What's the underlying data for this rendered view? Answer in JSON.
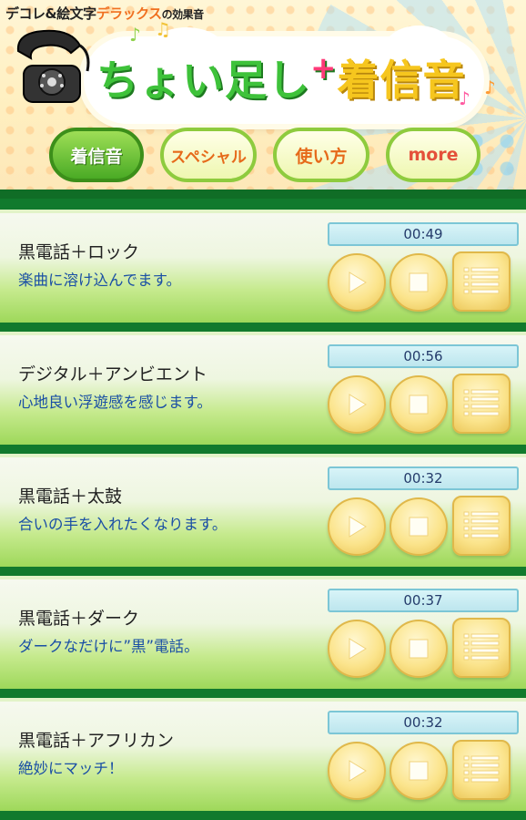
{
  "header": {
    "brand_prefix": "デコレ&絵文字",
    "brand_deluxe": "デラックス",
    "brand_suffix": "の効果音",
    "logo_part1": "ちょい足し",
    "logo_plus": "+",
    "logo_part2": "着信音",
    "icons": [
      "telephone-icon",
      "music-note-icon"
    ]
  },
  "nav": {
    "tabs": [
      {
        "label": "着信音",
        "active": true
      },
      {
        "label": "スペシャル",
        "active": false
      },
      {
        "label": "使い方",
        "active": false
      },
      {
        "label": "more",
        "active": false
      }
    ]
  },
  "ringtones": [
    {
      "title": "黒電話＋ロック",
      "desc": "楽曲に溶け込んでます。",
      "time": "00:49"
    },
    {
      "title": "デジタル＋アンビエント",
      "desc": "心地良い浮遊感を感じます。",
      "time": "00:56"
    },
    {
      "title": "黒電話＋太鼓",
      "desc": "合いの手を入れたくなります。",
      "time": "00:32"
    },
    {
      "title": "黒電話＋ダーク",
      "desc": "ダークなだけに”黒”電話。",
      "time": "00:37"
    },
    {
      "title": "黒電話＋アフリカン",
      "desc": "絶妙にマッチ！",
      "time": "00:32"
    }
  ],
  "row_icons": [
    "play-icon",
    "stop-icon",
    "list-icon"
  ],
  "colors": {
    "accent_green": "#3ec23a",
    "dark_green": "#117a2d",
    "button_yellow": "#fbe48c",
    "desc_blue": "#1a4fa5"
  }
}
